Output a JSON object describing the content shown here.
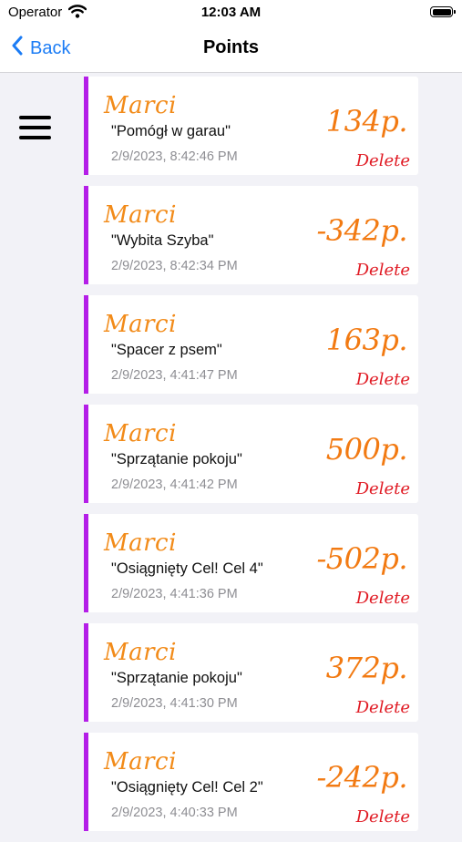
{
  "status_bar": {
    "carrier": "Operator",
    "time": "12:03 AM"
  },
  "nav": {
    "back_label": "Back",
    "title": "Points"
  },
  "entries": [
    {
      "name": "Marci",
      "description": "\"Pomógł w garau\"",
      "date": "2/9/2023, 8:42:46 PM",
      "points": "134p.",
      "delete_label": "Delete"
    },
    {
      "name": "Marci",
      "description": "\"Wybita Szyba\"",
      "date": "2/9/2023, 8:42:34 PM",
      "points": "-342p.",
      "delete_label": "Delete"
    },
    {
      "name": "Marci",
      "description": "\"Spacer z psem\"",
      "date": "2/9/2023, 4:41:47 PM",
      "points": "163p.",
      "delete_label": "Delete"
    },
    {
      "name": "Marci",
      "description": "\"Sprzątanie pokoju\"",
      "date": "2/9/2023, 4:41:42 PM",
      "points": "500p.",
      "delete_label": "Delete"
    },
    {
      "name": "Marci",
      "description": "\"Osiągnięty Cel! Cel 4\"",
      "date": "2/9/2023, 4:41:36 PM",
      "points": "-502p.",
      "delete_label": "Delete"
    },
    {
      "name": "Marci",
      "description": "\"Sprzątanie pokoju\"",
      "date": "2/9/2023, 4:41:30 PM",
      "points": "372p.",
      "delete_label": "Delete"
    },
    {
      "name": "Marci",
      "description": "\"Osiągnięty Cel! Cel 2\"",
      "date": "2/9/2023, 4:40:33 PM",
      "points": "-242p.",
      "delete_label": "Delete"
    }
  ],
  "colors": {
    "accent_bar": "#b41ee8",
    "name": "#f28b19",
    "points": "#f27a12",
    "delete": "#e01b24",
    "link": "#1b7cf5"
  }
}
